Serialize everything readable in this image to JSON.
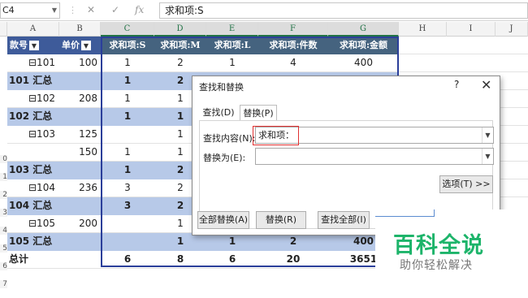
{
  "formula_bar": {
    "name_box": "C4",
    "fx": "fx",
    "formula": "求和项:S"
  },
  "columns": [
    "A",
    "B",
    "C",
    "D",
    "E",
    "F",
    "G",
    "H",
    "I",
    "J"
  ],
  "row_numbers": [
    "4",
    "",
    "",
    "",
    "",
    "",
    "",
    "",
    "0",
    "1",
    "2",
    "3",
    "4",
    "5",
    "6",
    "7",
    ""
  ],
  "pivot": {
    "header": {
      "key": "款号",
      "price": "单价",
      "c": "求和项:S",
      "d": "求和项:M",
      "e": "求和项:L",
      "f": "求和项:件数",
      "g": "求和项:金额"
    },
    "rows": [
      {
        "a": "⊟101",
        "b": "100",
        "c": "1",
        "d": "2",
        "e": "1",
        "f": "4",
        "g": "400",
        "bold": false,
        "blue": false
      },
      {
        "a": "101 汇总",
        "b": "",
        "c": "1",
        "d": "2",
        "e": "",
        "f": "",
        "g": "",
        "bold": true,
        "blue": true
      },
      {
        "a": "⊟102",
        "b": "208",
        "c": "1",
        "d": "1",
        "e": "",
        "f": "",
        "g": "",
        "bold": false,
        "blue": false
      },
      {
        "a": "102 汇总",
        "b": "",
        "c": "1",
        "d": "1",
        "e": "",
        "f": "",
        "g": "",
        "bold": true,
        "blue": true
      },
      {
        "a": "⊟103",
        "b": "125",
        "c": "",
        "d": "1",
        "e": "",
        "f": "",
        "g": "",
        "bold": false,
        "blue": false
      },
      {
        "a": "",
        "b": "150",
        "c": "1",
        "d": "1",
        "e": "",
        "f": "",
        "g": "",
        "bold": false,
        "blue": false
      },
      {
        "a": "103 汇总",
        "b": "",
        "c": "1",
        "d": "2",
        "e": "",
        "f": "",
        "g": "",
        "bold": true,
        "blue": true
      },
      {
        "a": "⊟104",
        "b": "236",
        "c": "3",
        "d": "2",
        "e": "",
        "f": "",
        "g": "",
        "bold": false,
        "blue": false
      },
      {
        "a": "104 汇总",
        "b": "",
        "c": "3",
        "d": "2",
        "e": "",
        "f": "",
        "g": "",
        "bold": true,
        "blue": true
      },
      {
        "a": "⊟105",
        "b": "200",
        "c": "",
        "d": "1",
        "e": "",
        "f": "",
        "g": "",
        "bold": false,
        "blue": false
      },
      {
        "a": "105 汇总",
        "b": "",
        "c": "",
        "d": "1",
        "e": "1",
        "f": "2",
        "g": "400",
        "bold": true,
        "blue": true
      },
      {
        "a": "总计",
        "b": "",
        "c": "6",
        "d": "8",
        "e": "6",
        "f": "20",
        "g": "3651",
        "bold": true,
        "blue": false
      }
    ]
  },
  "dialog": {
    "title": "查找和替换",
    "help": "?",
    "close": "✕",
    "tab_find": "查找(D)",
    "tab_replace": "替换(P)",
    "find_label": "查找内容(N):",
    "find_value": "求和项：",
    "replace_label": "替换为(E):",
    "replace_value": "",
    "options_button": "选项(T) >>",
    "replace_all_button": "全部替换(A)",
    "replace_button": "替换(R)",
    "find_all_button": "查找全部(I)"
  },
  "watermark": {
    "title": "百科全说",
    "subtitle": "助你轻松解决"
  }
}
